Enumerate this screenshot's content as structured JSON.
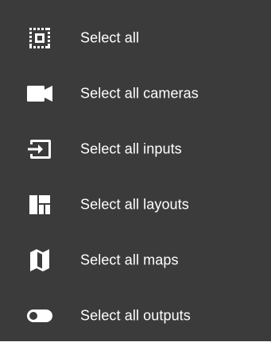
{
  "menu": {
    "items": [
      {
        "label": "Select all",
        "icon": "select-all-icon"
      },
      {
        "label": "Select all cameras",
        "icon": "camera-icon"
      },
      {
        "label": "Select all inputs",
        "icon": "input-icon"
      },
      {
        "label": "Select all layouts",
        "icon": "layout-icon"
      },
      {
        "label": "Select all maps",
        "icon": "map-icon"
      },
      {
        "label": "Select all outputs",
        "icon": "toggle-icon"
      }
    ]
  },
  "colors": {
    "background": "#3b3b3b",
    "foreground": "#ffffff"
  }
}
